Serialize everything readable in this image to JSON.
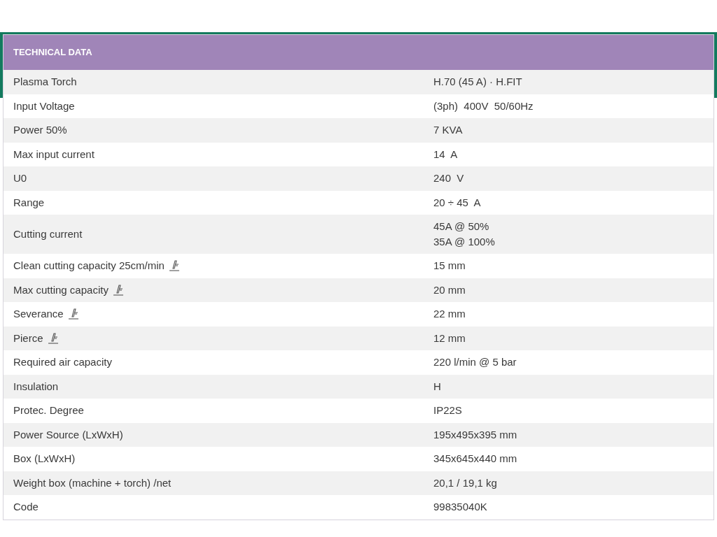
{
  "table": {
    "title": "TECHNICAL DATA",
    "rows": [
      {
        "label": "Plasma Torch",
        "torch_icon": false,
        "values": [
          "H.70 (45 A) · H.FIT"
        ]
      },
      {
        "label": "Input Voltage",
        "torch_icon": false,
        "values": [
          "(3ph)  400V  50/60Hz"
        ]
      },
      {
        "label": "Power 50%",
        "torch_icon": false,
        "values": [
          "7 KVA"
        ]
      },
      {
        "label": "Max input current",
        "torch_icon": false,
        "values": [
          "14  A"
        ]
      },
      {
        "label": "U0",
        "torch_icon": false,
        "values": [
          "240  V"
        ]
      },
      {
        "label": "Range",
        "torch_icon": false,
        "values": [
          "20 ÷ 45  A"
        ]
      },
      {
        "label": "Cutting current",
        "torch_icon": false,
        "values": [
          "45A @ 50%",
          "35A @ 100%"
        ]
      },
      {
        "label": "Clean cutting capacity 25cm/min",
        "torch_icon": true,
        "values": [
          "15 mm"
        ]
      },
      {
        "label": "Max cutting capacity",
        "torch_icon": true,
        "values": [
          "20 mm"
        ]
      },
      {
        "label": "Severance",
        "torch_icon": true,
        "values": [
          "22 mm"
        ]
      },
      {
        "label": "Pierce",
        "torch_icon": true,
        "values": [
          "12 mm"
        ]
      },
      {
        "label": "Required air capacity",
        "torch_icon": false,
        "values": [
          "220 l/min @ 5 bar"
        ]
      },
      {
        "label": "Insulation",
        "torch_icon": false,
        "values": [
          "H"
        ]
      },
      {
        "label": "Protec. Degree",
        "torch_icon": false,
        "values": [
          "IP22S"
        ]
      },
      {
        "label": "Power Source (LxWxH)",
        "torch_icon": false,
        "values": [
          "195x495x395 mm"
        ]
      },
      {
        "label": "Box (LxWxH)",
        "torch_icon": false,
        "values": [
          "345x645x440 mm"
        ]
      },
      {
        "label": "Weight box (machine + torch) /net",
        "torch_icon": false,
        "values": [
          "20,1 / 19,1 kg"
        ]
      },
      {
        "label": "Code",
        "torch_icon": false,
        "values": [
          "99835040K"
        ]
      }
    ]
  }
}
